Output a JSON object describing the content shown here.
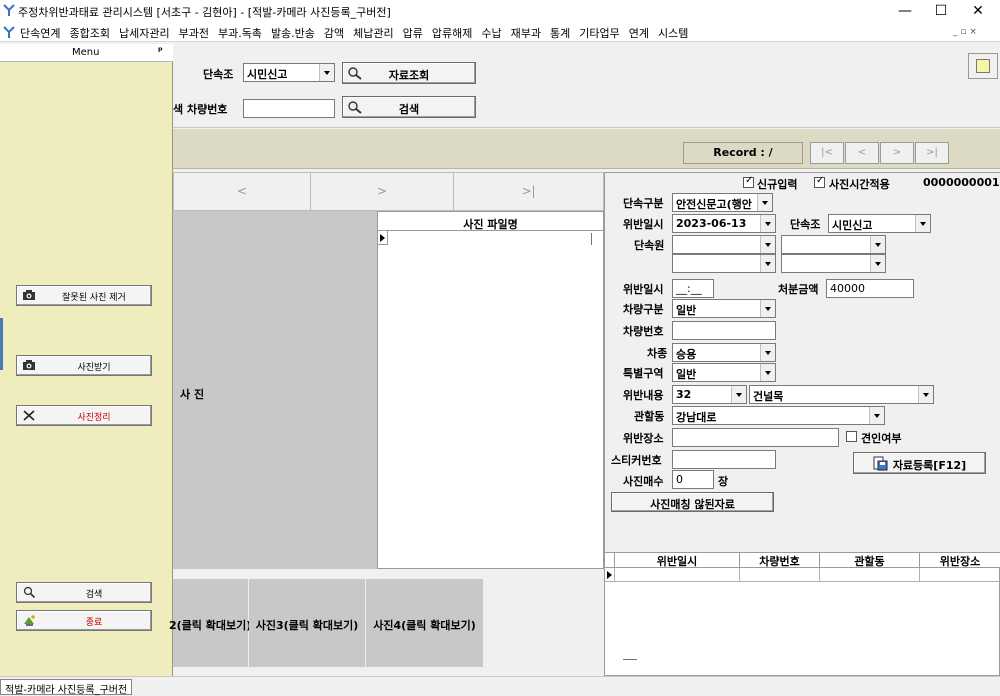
{
  "window": {
    "title": "주정차위반과태료 관리시스템    [서초구 - 김현아] - [적발-카메라 사진등록_구버전]",
    "minimize": "—",
    "maximize": "☐",
    "close": "✕"
  },
  "menubar": {
    "items": [
      "단속연계",
      "종합조회",
      "납세자관리",
      "부과전",
      "부과.독촉",
      "발송.반송",
      "감액",
      "체납관리",
      "압류",
      "압류해제",
      "수납",
      "재부과",
      "통계",
      "기타업무",
      "연계",
      "시스템"
    ],
    "mdi_controls": "_  ▫  ×"
  },
  "menu_panel": {
    "title": "Menu",
    "pin": "ᵖ",
    "buttons": [
      {
        "label": "잘못된 사진 제거",
        "icon": "camera-icon"
      },
      {
        "label": "사진받기",
        "icon": "camera-icon"
      },
      {
        "label": "사진정리",
        "icon": "close-icon"
      },
      {
        "label": "검색",
        "icon": "search-person-icon"
      },
      {
        "label": "종료",
        "icon": "exit-icon"
      }
    ]
  },
  "toolbar": {
    "enforcement_team_label": "단속조",
    "enforcement_team_value": "시민신고",
    "lookup_button": "자료조회",
    "vehicle_search_label": "색 차량번호",
    "vehicle_search_value": "",
    "search_button": "검색"
  },
  "record": {
    "label": "Record : /",
    "nav": [
      "|<",
      "<",
      ">",
      ">|"
    ]
  },
  "photo_nav": [
    "<",
    ">",
    ">|"
  ],
  "photo": {
    "label": "사 진",
    "filelist_header": "사진 파일명"
  },
  "thumbnails": [
    "2(클릭 확대보기)",
    "사진3(클릭 확대보기)",
    "사진4(클릭 확대보기)"
  ],
  "form": {
    "new_input_label": "신규입력",
    "new_input_checked": true,
    "photo_time_label": "사진시간적용",
    "photo_time_checked": true,
    "record_id": "0000000001",
    "category_label": "단속구분",
    "category_value": "안전신문고(행안",
    "violation_date_label": "위반일시",
    "violation_date_value": "2023-06-13",
    "team_label": "단속조",
    "team_value": "시민신고",
    "officer_label": "단속원",
    "violation_time_label": "위반일시",
    "violation_time_value": "__:__",
    "penalty_label": "처분금액",
    "penalty_value": "40000",
    "vehicle_type_label": "차량구분",
    "vehicle_type_value": "일반",
    "plate_label": "차량번호",
    "plate_value": "",
    "car_kind_label": "차종",
    "car_kind_value": "승용",
    "special_zone_label": "특별구역",
    "special_zone_value": "일반",
    "violation_label": "위반내용",
    "violation_code": "32",
    "violation_desc": "건널목",
    "district_label": "관할동",
    "district_value": "강남대로",
    "location_label": "위반장소",
    "location_value": "",
    "tow_label": "견인여부",
    "sticker_label": "스티커번호",
    "sticker_value": "",
    "photo_count_label": "사진매수",
    "photo_count_value": "0",
    "photo_count_unit": "장",
    "register_button": "자료등록[F12]",
    "unmatched_button": "사진매칭 않된자료",
    "grid_headers": [
      "위반일시",
      "차량번호",
      "관할동",
      "위반장소"
    ]
  },
  "status": {
    "tab": "적발-카메라 사진등록_구버전"
  }
}
